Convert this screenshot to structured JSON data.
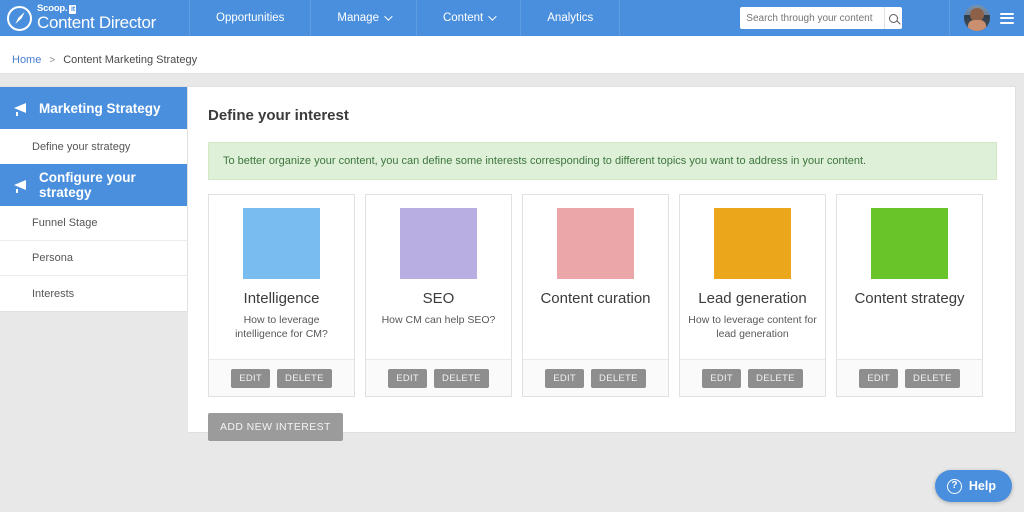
{
  "brand": {
    "badge_text": "it",
    "name_top": "Scoop.",
    "name_main": "Content Director",
    "compass_icon": "compass-icon"
  },
  "nav": {
    "items": [
      {
        "label": "Opportunities",
        "has_chevron": false
      },
      {
        "label": "Manage",
        "has_chevron": true
      },
      {
        "label": "Content",
        "has_chevron": true
      },
      {
        "label": "Analytics",
        "has_chevron": false
      }
    ]
  },
  "search": {
    "placeholder": "Search through your content",
    "value": "",
    "icon": "search-icon"
  },
  "user": {
    "avatar_label": "user-avatar",
    "menu_icon": "hamburger-menu-icon"
  },
  "breadcrumb": {
    "home": "Home",
    "separator": ">",
    "current": "Content Marketing Strategy"
  },
  "sidebar": {
    "sections": [
      {
        "header": "Marketing Strategy",
        "icon": "megaphone-icon",
        "items": [
          "Define your strategy"
        ]
      },
      {
        "header": "Configure your strategy",
        "icon": "megaphone-icon",
        "items": [
          "Funnel Stage",
          "Persona",
          "Interests"
        ]
      }
    ]
  },
  "main": {
    "title": "Define your interest",
    "notice": "To better organize your content, you can define some interests corresponding to different topics you want to address in your content.",
    "add_button": "ADD NEW INTEREST",
    "card_actions": {
      "edit": "EDIT",
      "delete": "DELETE"
    },
    "cards": [
      {
        "title": "Intelligence",
        "description": "How to leverage intelligence for CM?",
        "color": "#78bcf0"
      },
      {
        "title": "SEO",
        "description": "How CM can help SEO?",
        "color": "#b9aee2"
      },
      {
        "title": "Content curation",
        "description": "",
        "color": "#eaa6a8"
      },
      {
        "title": "Lead generation",
        "description": "How to leverage content for lead generation",
        "color": "#eba61c"
      },
      {
        "title": "Content strategy",
        "description": "",
        "color": "#69c42a"
      }
    ]
  },
  "help": {
    "label": "Help",
    "icon": "question-circle-icon"
  },
  "colors": {
    "brand_blue": "#4a8fdd",
    "notice_bg": "#dff0d8",
    "notice_text": "#3c763d",
    "button_gray": "#8e8e8e",
    "page_bg": "#e8e8e8"
  }
}
